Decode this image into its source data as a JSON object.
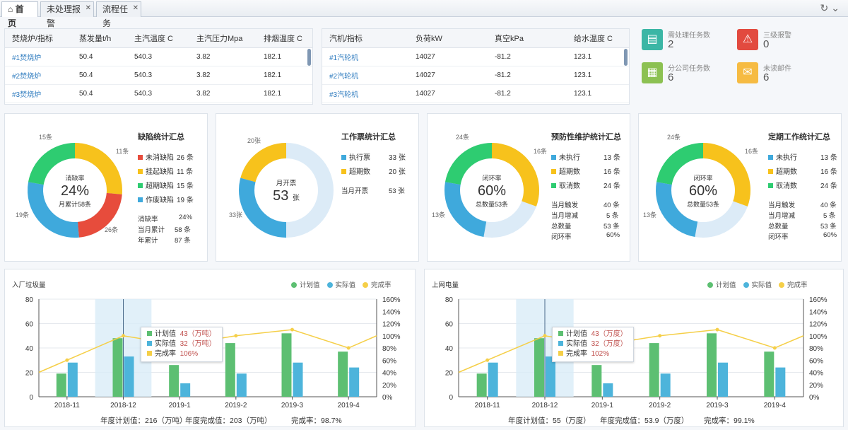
{
  "tabs": [
    {
      "label": "首页"
    },
    {
      "label": "未处理报警"
    },
    {
      "label": "流程任务"
    }
  ],
  "boilers": {
    "headers": [
      "焚烧炉/指标",
      "蒸发量t/h",
      "主汽温度 C",
      "主汽压力Mpa",
      "排烟温度 C"
    ],
    "rows": [
      [
        "#1焚烧炉",
        "50.4",
        "540.3",
        "3.82",
        "182.1"
      ],
      [
        "#2焚烧炉",
        "50.4",
        "540.3",
        "3.82",
        "182.1"
      ],
      [
        "#3焚烧炉",
        "50.4",
        "540.3",
        "3.82",
        "182.1"
      ]
    ]
  },
  "turbines": {
    "headers": [
      "汽机/指标",
      "负荷kW",
      "真空kPa",
      "给水温度 C"
    ],
    "rows": [
      [
        "#1汽轮机",
        "14027",
        "-81.2",
        "123.1"
      ],
      [
        "#2汽轮机",
        "14027",
        "-81.2",
        "123.1"
      ],
      [
        "#3汽轮机",
        "14027",
        "-81.2",
        "123.1"
      ]
    ]
  },
  "stats": [
    {
      "label": "需处理任务数",
      "value": "2",
      "color": "#3bb6a5",
      "icon": "clipboard-icon"
    },
    {
      "label": "三级报警",
      "value": "0",
      "color": "#e24a3f",
      "icon": "alarm-icon"
    },
    {
      "label": "分公司任务数",
      "value": "6",
      "color": "#8cc152",
      "icon": "building-icon"
    },
    {
      "label": "未读邮件",
      "value": "6",
      "color": "#f6bb42",
      "icon": "mail-icon"
    }
  ],
  "defect": {
    "title": "缺陷统计汇总",
    "center_label": "消缺率",
    "center_value": "24%",
    "center_sub": "月累计58条",
    "items": [
      {
        "label": "未消缺陷",
        "value": "26 条",
        "n": 26,
        "color": "#e74c3c"
      },
      {
        "label": "挂起缺陷",
        "value": "11 条",
        "n": 11,
        "color": "#f7c21c"
      },
      {
        "label": "超期缺陷",
        "value": "15 条",
        "n": 15,
        "color": "#2ecc71"
      },
      {
        "label": "作废缺陷",
        "value": "19 条",
        "n": 19,
        "color": "#3fa9dc"
      }
    ],
    "outer": [
      "15条",
      "11条",
      "19条",
      "26条"
    ],
    "summary": [
      {
        "label": "消缺率",
        "value": "24%"
      },
      {
        "label": "当月累计",
        "value": "58 条"
      },
      {
        "label": "年累计",
        "value": "87 条"
      }
    ]
  },
  "ticket": {
    "title": "工作票统计汇总",
    "center_label": "月开票",
    "center_value": "53",
    "center_unit": "张",
    "items": [
      {
        "label": "执行票",
        "value": "33 张",
        "n": 33,
        "color": "#3fa9dc"
      },
      {
        "label": "超期数",
        "value": "20 张",
        "n": 20,
        "color": "#f7c21c"
      }
    ],
    "outer": [
      "20张",
      "33张"
    ],
    "summary": [
      {
        "label": "当月开票",
        "value": "53 张"
      }
    ]
  },
  "preventive": {
    "title": "预防性维护统计汇总",
    "center_label": "闭环率",
    "center_value": "60%",
    "center_sub": "总数量53条",
    "items": [
      {
        "label": "未执行",
        "value": "13 条",
        "n": 13,
        "color": "#3fa9dc"
      },
      {
        "label": "超期数",
        "value": "16 条",
        "n": 16,
        "color": "#f7c21c"
      },
      {
        "label": "取消数",
        "value": "24 条",
        "n": 24,
        "color": "#2ecc71"
      }
    ],
    "outer": [
      "24条",
      "16条",
      "13条"
    ],
    "summary": [
      {
        "label": "当月触发",
        "value": "40 条"
      },
      {
        "label": "当月增减",
        "value": "5 条"
      },
      {
        "label": "总数量",
        "value": "53 条"
      },
      {
        "label": "闭环率",
        "value": "60%"
      }
    ]
  },
  "periodic": {
    "title": "定期工作统计汇总",
    "center_label": "闭环率",
    "center_value": "60%",
    "center_sub": "总数量53条",
    "items": [
      {
        "label": "未执行",
        "value": "13 条",
        "n": 13,
        "color": "#3fa9dc"
      },
      {
        "label": "超期数",
        "value": "16 条",
        "n": 16,
        "color": "#f7c21c"
      },
      {
        "label": "取消数",
        "value": "24 条",
        "n": 24,
        "color": "#2ecc71"
      }
    ],
    "outer": [
      "24条",
      "16条",
      "13条"
    ],
    "summary": [
      {
        "label": "当月触发",
        "value": "40 条"
      },
      {
        "label": "当月增减",
        "value": "5 条"
      },
      {
        "label": "总数量",
        "value": "53 条"
      },
      {
        "label": "闭环率",
        "value": "60%"
      }
    ]
  },
  "chart_legend": {
    "plan": "计划值",
    "actual": "实际值",
    "rate": "完成率"
  },
  "chart_data": [
    {
      "type": "bar",
      "title": "入厂垃圾量",
      "categories": [
        "2018-11",
        "2018-12",
        "2019-1",
        "2019-2",
        "2019-3",
        "2019-4"
      ],
      "ylim": [
        0,
        80
      ],
      "y2lim": [
        0,
        160
      ],
      "yticks": [
        "0",
        "20",
        "40",
        "60",
        "80"
      ],
      "y2ticks": [
        "0%",
        "20%",
        "40%",
        "60%",
        "80%",
        "100%",
        "120%",
        "140%",
        "160%"
      ],
      "series": [
        {
          "name": "计划值",
          "values": [
            19,
            48,
            26,
            44,
            52,
            37
          ],
          "color": "#5dbf72"
        },
        {
          "name": "实际值",
          "values": [
            28,
            33,
            11,
            19,
            28,
            24
          ],
          "color": "#4db4db"
        },
        {
          "name": "完成率",
          "values": [
            60,
            100,
            85,
            100,
            110,
            80
          ],
          "color": "#f5cf48",
          "axis": "right"
        }
      ],
      "highlight": 1,
      "tooltip": {
        "rows": [
          {
            "label": "计划值",
            "value": "43（万吨）"
          },
          {
            "label": "实际值",
            "value": "32（万吨）"
          },
          {
            "label": "完成率",
            "value": "106%"
          }
        ]
      },
      "footer": [
        {
          "label": "年度计划值：",
          "value": "216（万吨）"
        },
        {
          "label": "年度完成值：",
          "value": "203（万吨）"
        },
        {
          "label": "完成率：",
          "value": "98.7%"
        }
      ]
    },
    {
      "type": "bar",
      "title": "上网电量",
      "categories": [
        "2018-11",
        "2018-12",
        "2019-1",
        "2019-2",
        "2019-3",
        "2019-4"
      ],
      "ylim": [
        0,
        80
      ],
      "y2lim": [
        0,
        160
      ],
      "yticks": [
        "0",
        "20",
        "40",
        "60",
        "80"
      ],
      "y2ticks": [
        "0%",
        "20%",
        "40%",
        "60%",
        "80%",
        "100%",
        "120%",
        "140%",
        "160%"
      ],
      "series": [
        {
          "name": "计划值",
          "values": [
            19,
            48,
            26,
            44,
            52,
            37
          ],
          "color": "#5dbf72"
        },
        {
          "name": "实际值",
          "values": [
            28,
            33,
            11,
            19,
            28,
            24
          ],
          "color": "#4db4db"
        },
        {
          "name": "完成率",
          "values": [
            60,
            100,
            85,
            100,
            110,
            80
          ],
          "color": "#f5cf48",
          "axis": "right"
        }
      ],
      "highlight": 1,
      "tooltip": {
        "rows": [
          {
            "label": "计划值",
            "value": "43（万度）"
          },
          {
            "label": "实际值",
            "value": "32（万度）"
          },
          {
            "label": "完成率",
            "value": "102%"
          }
        ]
      },
      "footer": [
        {
          "label": "年度计划值：",
          "value": "55（万度）"
        },
        {
          "label": "年度完成值：",
          "value": "53.9（万度）"
        },
        {
          "label": "完成率：",
          "value": "99.1%"
        }
      ]
    }
  ]
}
